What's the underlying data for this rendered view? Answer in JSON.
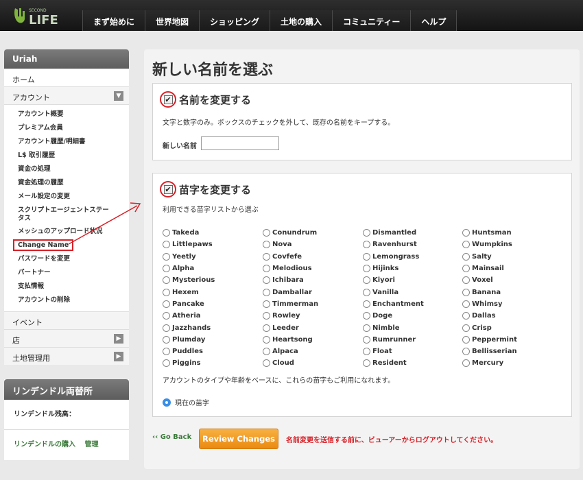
{
  "brand": {
    "logo_small": "SECOND",
    "logo_large": "LIFE"
  },
  "nav": [
    "まず始めに",
    "世界地図",
    "ショッピング",
    "土地の購入",
    "コミュニティー",
    "ヘルプ"
  ],
  "sidebar": {
    "user": "Uriah",
    "home": "ホーム",
    "account": "アカウント",
    "account_items": [
      "アカウント概要",
      "プレミアム会員",
      "アカウント履歴/明細書",
      "L$ 取引履歴",
      "資金の処理",
      "資金処理の履歴",
      "メール設定の変更",
      "スクリプトエージェントステータス",
      "メッシュのアップロード状況",
      "Change Name",
      "パスワードを変更",
      "パートナー",
      "支払情報",
      "アカウントの削除"
    ],
    "events": "イベント",
    "store": "店",
    "land": "土地管理用"
  },
  "linden": {
    "title": "リンデンドル両替所",
    "balance_label": "リンデンドル残高：",
    "buy": "リンデンドルの購入",
    "manage": "管理"
  },
  "main": {
    "title": "新しい名前を選ぶ",
    "name_section": {
      "title": "名前を変更する",
      "desc": "文字と数字のみ。ボックスのチェックを外して、既存の名前をキープする。",
      "new_name_label": "新しい名前",
      "new_name_value": ""
    },
    "surname_section": {
      "title": "苗字を変更する",
      "desc": "利用できる苗字リストから選ぶ",
      "columns": [
        [
          "Takeda",
          "Littlepaws",
          "Yeetly",
          "Alpha",
          "Mysterious",
          "Hexem",
          "Pancake",
          "Atheria",
          "Jazzhands",
          "Plumday",
          "Puddles",
          "Piggins"
        ],
        [
          "Conundrum",
          "Nova",
          "Covfefe",
          "Melodious",
          "Ichibara",
          "Damballar",
          "Timmerman",
          "Rowley",
          "Leeder",
          "Heartsong",
          "Alpaca",
          "Cloud"
        ],
        [
          "Dismantled",
          "Ravenhurst",
          "Lemongrass",
          "Hijinks",
          "Kiyori",
          "Vanilla",
          "Enchantment",
          "Doge",
          "Nimble",
          "Rumrunner",
          "Float",
          "Resident"
        ],
        [
          "Huntsman",
          "Wumpkins",
          "Salty",
          "Mainsail",
          "Voxel",
          "Banana",
          "Whimsy",
          "Dallas",
          "Crisp",
          "Peppermint",
          "Bellisserian",
          "Mercury"
        ]
      ],
      "note": "アカウントのタイプや年齢をベースに、これらの苗字もご利用になれます。",
      "current": "現在の苗字"
    },
    "back": "‹‹ Go Back",
    "review": "Review Changes",
    "warning": "名前変更を送信する前に、ビューアーからログアウトしてください。"
  },
  "colors": {
    "accent_red": "#d81f26",
    "button_orange": "#f0a030",
    "link_green": "#3a7a3a",
    "radio_blue": "#3a8ee6"
  }
}
